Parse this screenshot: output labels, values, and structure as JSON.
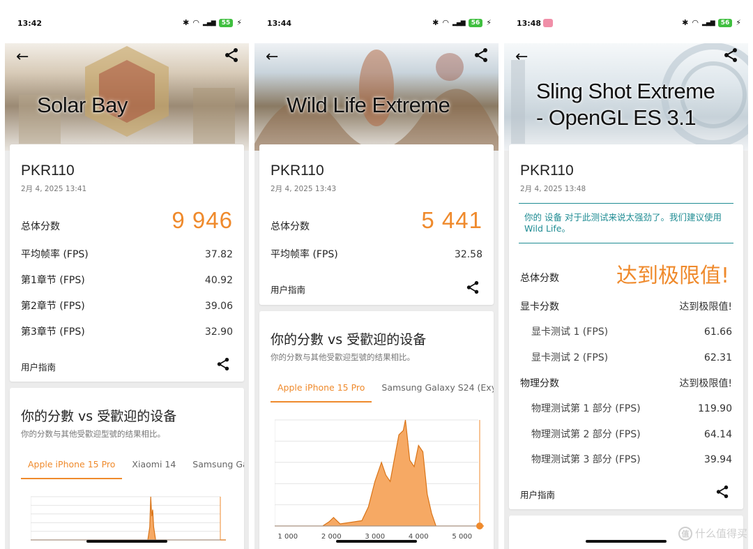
{
  "panels": [
    {
      "status": {
        "time": "13:42",
        "battery": "55"
      },
      "hero_title": "Solar Bay",
      "device": "PKR110",
      "date": "2月 4, 2025 13:41",
      "total_label": "总体分数",
      "total_value": "9 946",
      "rows": [
        {
          "label": "平均帧率 (FPS)",
          "value": "37.82"
        },
        {
          "label": "第1章节 (FPS)",
          "value": "40.92"
        },
        {
          "label": "第2章节 (FPS)",
          "value": "39.06"
        },
        {
          "label": "第3章节 (FPS)",
          "value": "32.90"
        }
      ],
      "guide": "用户指南",
      "compare_title": "你的分數 vs 受歡迎的设备",
      "compare_sub": "你的分数与其他受歡迎型號的结果相比。",
      "tabs": [
        "Apple iPhone 15 Pro",
        "Xiaomi 14",
        "Samsung Gal"
      ]
    },
    {
      "status": {
        "time": "13:44",
        "battery": "56"
      },
      "hero_title": "Wild Life Extreme",
      "device": "PKR110",
      "date": "2月 4, 2025 13:43",
      "total_label": "总体分数",
      "total_value": "5 441",
      "rows": [
        {
          "label": "平均帧率 (FPS)",
          "value": "32.58"
        }
      ],
      "guide": "用户指南",
      "compare_title": "你的分數 vs 受歡迎的设备",
      "compare_sub": "你的分数与其他受歡迎型號的结果相比。",
      "tabs": [
        "Apple iPhone 15 Pro",
        "Samsung Galaxy S24 (Exyr"
      ]
    },
    {
      "status": {
        "time": "13:48",
        "battery": "56"
      },
      "hero_title_1": "Sling Shot Extreme",
      "hero_title_2": "- OpenGL ES 3.1",
      "device": "PKR110",
      "date": "2月 4, 2025 13:48",
      "warning": "你的 设备 对于此测试来说太强劲了。我们建议使用 Wild Life。",
      "total_label": "总体分数",
      "total_value": "达到极限值!",
      "gpu_label": "显卡分数",
      "gpu_value": "达到极限值!",
      "gpu_rows": [
        {
          "label": "显卡测试 1 (FPS)",
          "value": "61.66"
        },
        {
          "label": "显卡测试 2 (FPS)",
          "value": "62.31"
        }
      ],
      "phys_label": "物理分数",
      "phys_value": "达到极限值!",
      "phys_rows": [
        {
          "label": "物理测试第 1 部分 (FPS)",
          "value": "119.90"
        },
        {
          "label": "物理测试第 2 部分 (FPS)",
          "value": "64.14"
        },
        {
          "label": "物理测试第 3 部分 (FPS)",
          "value": "39.94"
        }
      ],
      "guide": "用户指南"
    }
  ],
  "chart_data": [
    {
      "type": "area",
      "title": "",
      "x_ticks": [
        1000,
        2000,
        3000,
        4000,
        5000
      ],
      "xlim": [
        700,
        5500
      ],
      "x": [
        700,
        1800,
        1950,
        2050,
        2200,
        2700,
        2850,
        3000,
        3150,
        3250,
        3350,
        3450,
        3550,
        3650,
        3700,
        3800,
        3900,
        4000,
        4100,
        4200,
        4300,
        4400,
        5500
      ],
      "values": [
        0,
        0,
        4,
        8,
        2,
        5,
        18,
        42,
        60,
        48,
        42,
        64,
        86,
        90,
        100,
        62,
        56,
        76,
        70,
        30,
        12,
        0,
        0
      ],
      "marker_x": 5441,
      "accent": "#ef8a2c"
    },
    {
      "type": "area",
      "title": "",
      "x_ticks": [],
      "xlim": [
        0,
        100
      ],
      "x": [
        0,
        60,
        61,
        61.5,
        62,
        62.5,
        63,
        64,
        100
      ],
      "values": [
        0,
        0,
        30,
        100,
        55,
        70,
        30,
        0,
        0
      ],
      "accent": "#ef8a2c"
    }
  ],
  "watermark": "什么值得买",
  "watermark_badge": "值"
}
